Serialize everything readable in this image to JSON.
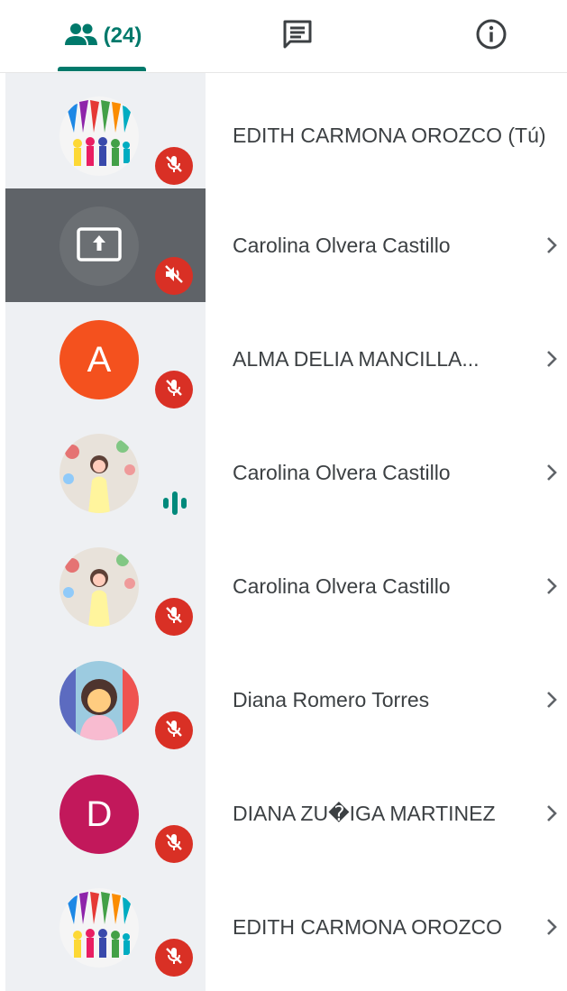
{
  "tabs": {
    "people_count": "(24)",
    "icons": {
      "people": "people-icon",
      "chat": "chat-icon",
      "info": "info-icon"
    },
    "active": "people",
    "accent": "#00796b"
  },
  "participants": [
    {
      "name": "EDITH CARMONA OROZCO (Tú)",
      "avatar": "photo",
      "status": "muted",
      "chevron": false
    },
    {
      "name": "Carolina Olvera Castillo",
      "avatar": "presenting",
      "status": "volume-off",
      "chevron": true
    },
    {
      "name": "ALMA DELIA MANCILLA...",
      "avatar": "letter",
      "letter": "A",
      "color": "#f4511e",
      "status": "muted",
      "chevron": true
    },
    {
      "name": "Carolina Olvera Castillo",
      "avatar": "photo",
      "status": "speaking",
      "chevron": true
    },
    {
      "name": "Carolina Olvera Castillo",
      "avatar": "photo",
      "status": "muted",
      "chevron": true
    },
    {
      "name": "Diana Romero Torres",
      "avatar": "photo",
      "status": "muted",
      "chevron": true
    },
    {
      "name": "DIANA ZU�IGA MARTINEZ",
      "avatar": "letter",
      "letter": "D",
      "color": "#c2185b",
      "status": "muted",
      "chevron": true
    },
    {
      "name": "EDITH CARMONA OROZCO",
      "avatar": "photo",
      "status": "muted",
      "chevron": true
    }
  ],
  "colors": {
    "muted_badge": "#d93025",
    "speaking": "#00897b",
    "left_strip": "#eef0f3",
    "presenting_bg": "#5f6368"
  }
}
